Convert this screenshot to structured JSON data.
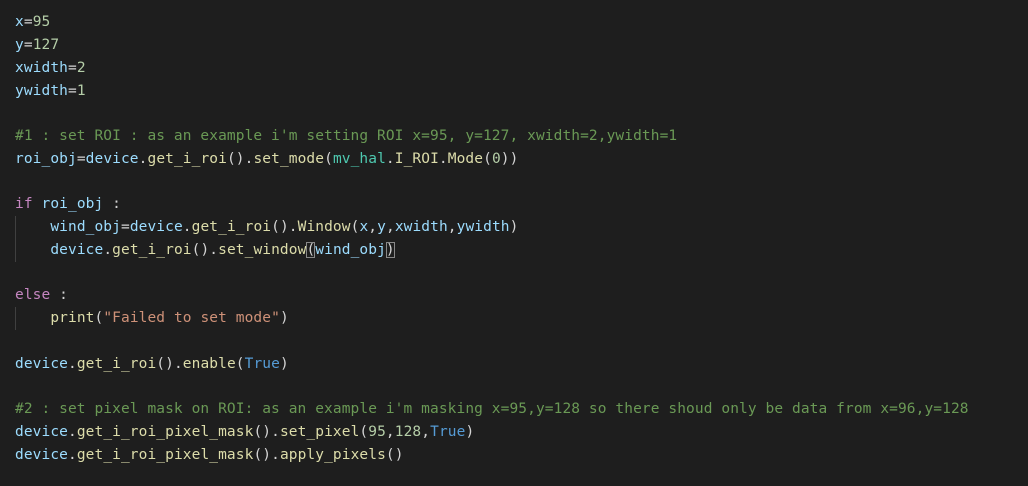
{
  "colors": {
    "background": "#1e1e1e",
    "default": "#d4d4d4",
    "variable": "#9cdcfe",
    "comment": "#6a9955",
    "keyword": "#c586c0",
    "function": "#dcdcaa",
    "string": "#ce9178",
    "number": "#b5cea8",
    "constant": "#569cd6",
    "class": "#4ec9b0",
    "indent_guide": "#404040",
    "bracket_match": "#888888"
  },
  "editor": {
    "lines": [
      {
        "text": "x=95",
        "tokens": [
          [
            "variable",
            "x"
          ],
          [
            "default",
            "="
          ],
          [
            "number",
            "95"
          ]
        ]
      },
      {
        "text": "y=127",
        "tokens": [
          [
            "variable",
            "y"
          ],
          [
            "default",
            "="
          ],
          [
            "number",
            "127"
          ]
        ]
      },
      {
        "text": "xwidth=2",
        "tokens": [
          [
            "variable",
            "xwidth"
          ],
          [
            "default",
            "="
          ],
          [
            "number",
            "2"
          ]
        ]
      },
      {
        "text": "ywidth=1",
        "tokens": [
          [
            "variable",
            "ywidth"
          ],
          [
            "default",
            "="
          ],
          [
            "number",
            "1"
          ]
        ]
      },
      {
        "text": "",
        "tokens": []
      },
      {
        "text": "#1 : set ROI : as an example i'm setting ROI x=95, y=127, xwidth=2,ywidth=1",
        "tokens": [
          [
            "comment",
            "#1 : set ROI : as an example i'm setting ROI x=95, y=127, xwidth=2,ywidth=1"
          ]
        ]
      },
      {
        "text": "roi_obj=device.get_i_roi().set_mode(mv_hal.I_ROI.Mode(0))",
        "tokens": [
          [
            "variable",
            "roi_obj"
          ],
          [
            "default",
            "="
          ],
          [
            "variable",
            "device"
          ],
          [
            "default",
            "."
          ],
          [
            "function",
            "get_i_roi"
          ],
          [
            "default",
            "()."
          ],
          [
            "function",
            "set_mode"
          ],
          [
            "default",
            "("
          ],
          [
            "class",
            "mv_hal"
          ],
          [
            "default",
            "."
          ],
          [
            "function",
            "I_ROI"
          ],
          [
            "default",
            "."
          ],
          [
            "function",
            "Mode"
          ],
          [
            "default",
            "("
          ],
          [
            "number",
            "0"
          ],
          [
            "default",
            "))"
          ]
        ]
      },
      {
        "text": "",
        "tokens": []
      },
      {
        "text": "if roi_obj :",
        "tokens": [
          [
            "keyword",
            "if"
          ],
          [
            "default",
            " "
          ],
          [
            "variable",
            "roi_obj"
          ],
          [
            "default",
            " :"
          ]
        ]
      },
      {
        "text": "    wind_obj=device.get_i_roi().Window(x,y,xwidth,ywidth)",
        "tokens": [
          [
            "default",
            "    "
          ],
          [
            "variable",
            "wind_obj"
          ],
          [
            "default",
            "="
          ],
          [
            "variable",
            "device"
          ],
          [
            "default",
            "."
          ],
          [
            "function",
            "get_i_roi"
          ],
          [
            "default",
            "()."
          ],
          [
            "function",
            "Window"
          ],
          [
            "default",
            "("
          ],
          [
            "variable",
            "x"
          ],
          [
            "default",
            ","
          ],
          [
            "variable",
            "y"
          ],
          [
            "default",
            ","
          ],
          [
            "variable",
            "xwidth"
          ],
          [
            "default",
            ","
          ],
          [
            "variable",
            "ywidth"
          ],
          [
            "default",
            ")"
          ]
        ]
      },
      {
        "text": "    device.get_i_roi().set_window(wind_obj)",
        "tokens": [
          [
            "default",
            "    "
          ],
          [
            "variable",
            "device"
          ],
          [
            "default",
            "."
          ],
          [
            "function",
            "get_i_roi"
          ],
          [
            "default",
            "()."
          ],
          [
            "function",
            "set_window"
          ],
          [
            "bracket",
            "("
          ],
          [
            "variable",
            "wind_obj"
          ],
          [
            "bracket",
            ")"
          ]
        ]
      },
      {
        "text": "",
        "tokens": []
      },
      {
        "text": "else :",
        "tokens": [
          [
            "keyword",
            "else"
          ],
          [
            "default",
            " :"
          ]
        ]
      },
      {
        "text": "    print(\"Failed to set mode\")",
        "tokens": [
          [
            "default",
            "    "
          ],
          [
            "function",
            "print"
          ],
          [
            "default",
            "("
          ],
          [
            "string",
            "\"Failed to set mode\""
          ],
          [
            "default",
            ")"
          ]
        ]
      },
      {
        "text": "",
        "tokens": []
      },
      {
        "text": "device.get_i_roi().enable(True)",
        "tokens": [
          [
            "variable",
            "device"
          ],
          [
            "default",
            "."
          ],
          [
            "function",
            "get_i_roi"
          ],
          [
            "default",
            "()."
          ],
          [
            "function",
            "enable"
          ],
          [
            "default",
            "("
          ],
          [
            "constant",
            "True"
          ],
          [
            "default",
            ")"
          ]
        ]
      },
      {
        "text": "",
        "tokens": []
      },
      {
        "text": "#2 : set pixel mask on ROI: as an example i'm masking x=95,y=128 so there shoud only be data from x=96,y=128",
        "tokens": [
          [
            "comment",
            "#2 : set pixel mask on ROI: as an example i'm masking x=95,y=128 so there shoud only be data from x=96,y=128"
          ]
        ]
      },
      {
        "text": "device.get_i_roi_pixel_mask().set_pixel(95,128,True)",
        "tokens": [
          [
            "variable",
            "device"
          ],
          [
            "default",
            "."
          ],
          [
            "function",
            "get_i_roi_pixel_mask"
          ],
          [
            "default",
            "()."
          ],
          [
            "function",
            "set_pixel"
          ],
          [
            "default",
            "("
          ],
          [
            "number",
            "95"
          ],
          [
            "default",
            ","
          ],
          [
            "number",
            "128"
          ],
          [
            "default",
            ","
          ],
          [
            "constant",
            "True"
          ],
          [
            "default",
            ")"
          ]
        ]
      },
      {
        "text": "device.get_i_roi_pixel_mask().apply_pixels()",
        "tokens": [
          [
            "variable",
            "device"
          ],
          [
            "default",
            "."
          ],
          [
            "function",
            "get_i_roi_pixel_mask"
          ],
          [
            "default",
            "()."
          ],
          [
            "function",
            "apply_pixels"
          ],
          [
            "default",
            "()"
          ]
        ]
      }
    ]
  }
}
